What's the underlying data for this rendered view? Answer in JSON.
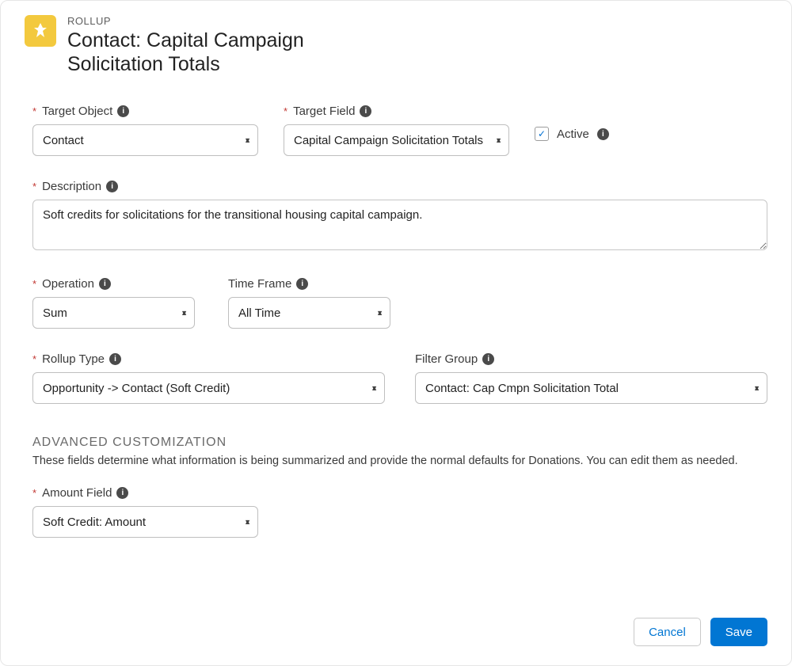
{
  "header": {
    "eyebrow": "ROLLUP",
    "title": "Contact: Capital Campaign Solicitation Totals"
  },
  "fields": {
    "target_object": {
      "label": "Target Object",
      "value": "Contact"
    },
    "target_field": {
      "label": "Target Field",
      "value": "Capital Campaign Solicitation Totals"
    },
    "active": {
      "label": "Active",
      "checked": true
    },
    "description": {
      "label": "Description",
      "value": "Soft credits for solicitations for the transitional housing capital campaign."
    },
    "operation": {
      "label": "Operation",
      "value": "Sum"
    },
    "time_frame": {
      "label": "Time Frame",
      "value": "All Time"
    },
    "rollup_type": {
      "label": "Rollup Type",
      "value": "Opportunity -> Contact (Soft Credit)"
    },
    "filter_group": {
      "label": "Filter Group",
      "value": "Contact: Cap Cmpn Solicitation Total"
    },
    "amount_field": {
      "label": "Amount Field",
      "value": "Soft Credit: Amount"
    }
  },
  "advanced": {
    "title": "ADVANCED CUSTOMIZATION",
    "desc": "These fields determine what information is being summarized and provide the normal defaults for Donations. You can edit them as needed."
  },
  "footer": {
    "cancel": "Cancel",
    "save": "Save"
  }
}
